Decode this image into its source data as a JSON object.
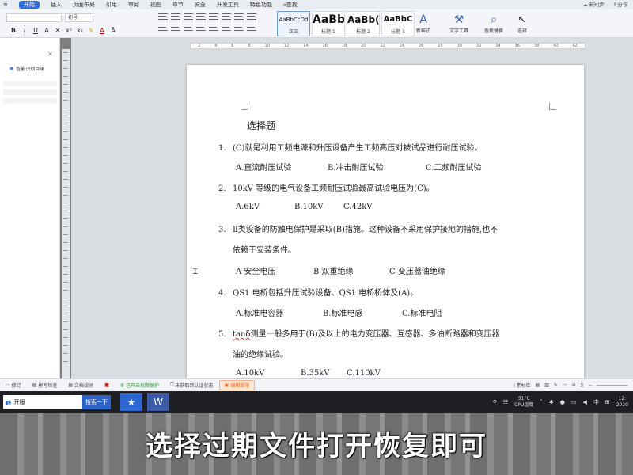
{
  "menubar": {
    "items": [
      {
        "label": "开始",
        "active": true
      },
      {
        "label": "插入"
      },
      {
        "label": "页面布局"
      },
      {
        "label": "引用"
      },
      {
        "label": "审阅"
      },
      {
        "label": "视图"
      },
      {
        "label": "章节"
      },
      {
        "label": "安全"
      },
      {
        "label": "开发工具"
      },
      {
        "label": "特色功能"
      },
      {
        "label": "查找"
      }
    ],
    "sync_status": "未同步",
    "share_label": "分享"
  },
  "ribbon": {
    "font_size_value": "初号",
    "styles": [
      {
        "sample": "AaBbCcDd",
        "caption": "正文"
      },
      {
        "sample": "AaBb",
        "caption": "标题 1"
      },
      {
        "sample": "AaBb(",
        "caption": "标题 2"
      },
      {
        "sample": "AaBbC",
        "caption": "标题 3"
      }
    ],
    "new_style_label": "新样式",
    "text_tools_label": "文字工具",
    "find_replace_label": "查找替换",
    "select_label": "选择"
  },
  "navpane": {
    "title": "智能识别目录"
  },
  "ruler_labels": [
    "2",
    "4",
    "6",
    "8",
    "10",
    "12",
    "14",
    "16",
    "18",
    "20",
    "22",
    "24",
    "26",
    "28",
    "30",
    "32",
    "34",
    "36",
    "38",
    "40",
    "42"
  ],
  "document": {
    "title": "选择题",
    "q1": {
      "num": "1.",
      "text": "(C)就是利用工频电源和升压设备产生工频高压对被试品进行耐压试验。",
      "opts": [
        "A.直流耐压试验",
        "B.冲击耐压试验",
        "C.工频耐压试验"
      ]
    },
    "q2": {
      "num": "2.",
      "text": "10kV 等级的电气设备工频耐压试验最高试验电压为(C)。",
      "opts": [
        "A.6kV",
        "B.10kV",
        "C.42kV"
      ]
    },
    "q3": {
      "num": "3.",
      "text": "Ⅱ类设备的防触电保护是采取(B)措施。这种设备不采用保护接地的措施,也不",
      "cont": "依赖于安装条件。",
      "opts": [
        "A 安全电压",
        "B 双重绝缘",
        "C 变压器油绝缘"
      ]
    },
    "q4": {
      "num": "4.",
      "text": "QS1 电桥包括升压试验设备、QS1 电桥桥体及(A)。",
      "opts": [
        "A.标准电容器",
        "B.标准电感",
        "C.标准电阻"
      ]
    },
    "q5": {
      "num": "5.",
      "text_prefix": "tanδ",
      "text": "测量一般多用于(B)及以上的电力变压器、互感器、多油断路器和变压器",
      "cont": "油的绝缘试验。",
      "opts": [
        "A.10kV",
        "B.35kV",
        "C.110kV"
      ]
    }
  },
  "statusbar": {
    "items": [
      "修订",
      "拼写检查",
      "文档校对"
    ],
    "protect": "已开启权限保护",
    "auth": "未获取到认证状态",
    "mode": "编辑受限",
    "material": "素材库"
  },
  "taskbar": {
    "search_value": "开服",
    "search_button": "搜索一下",
    "temp": "51°C",
    "cpu_label": "CPU温度",
    "lang": "中",
    "time_partial": "12:",
    "date_partial": "2020"
  },
  "caption": "选择过期文件打开恢复即可"
}
